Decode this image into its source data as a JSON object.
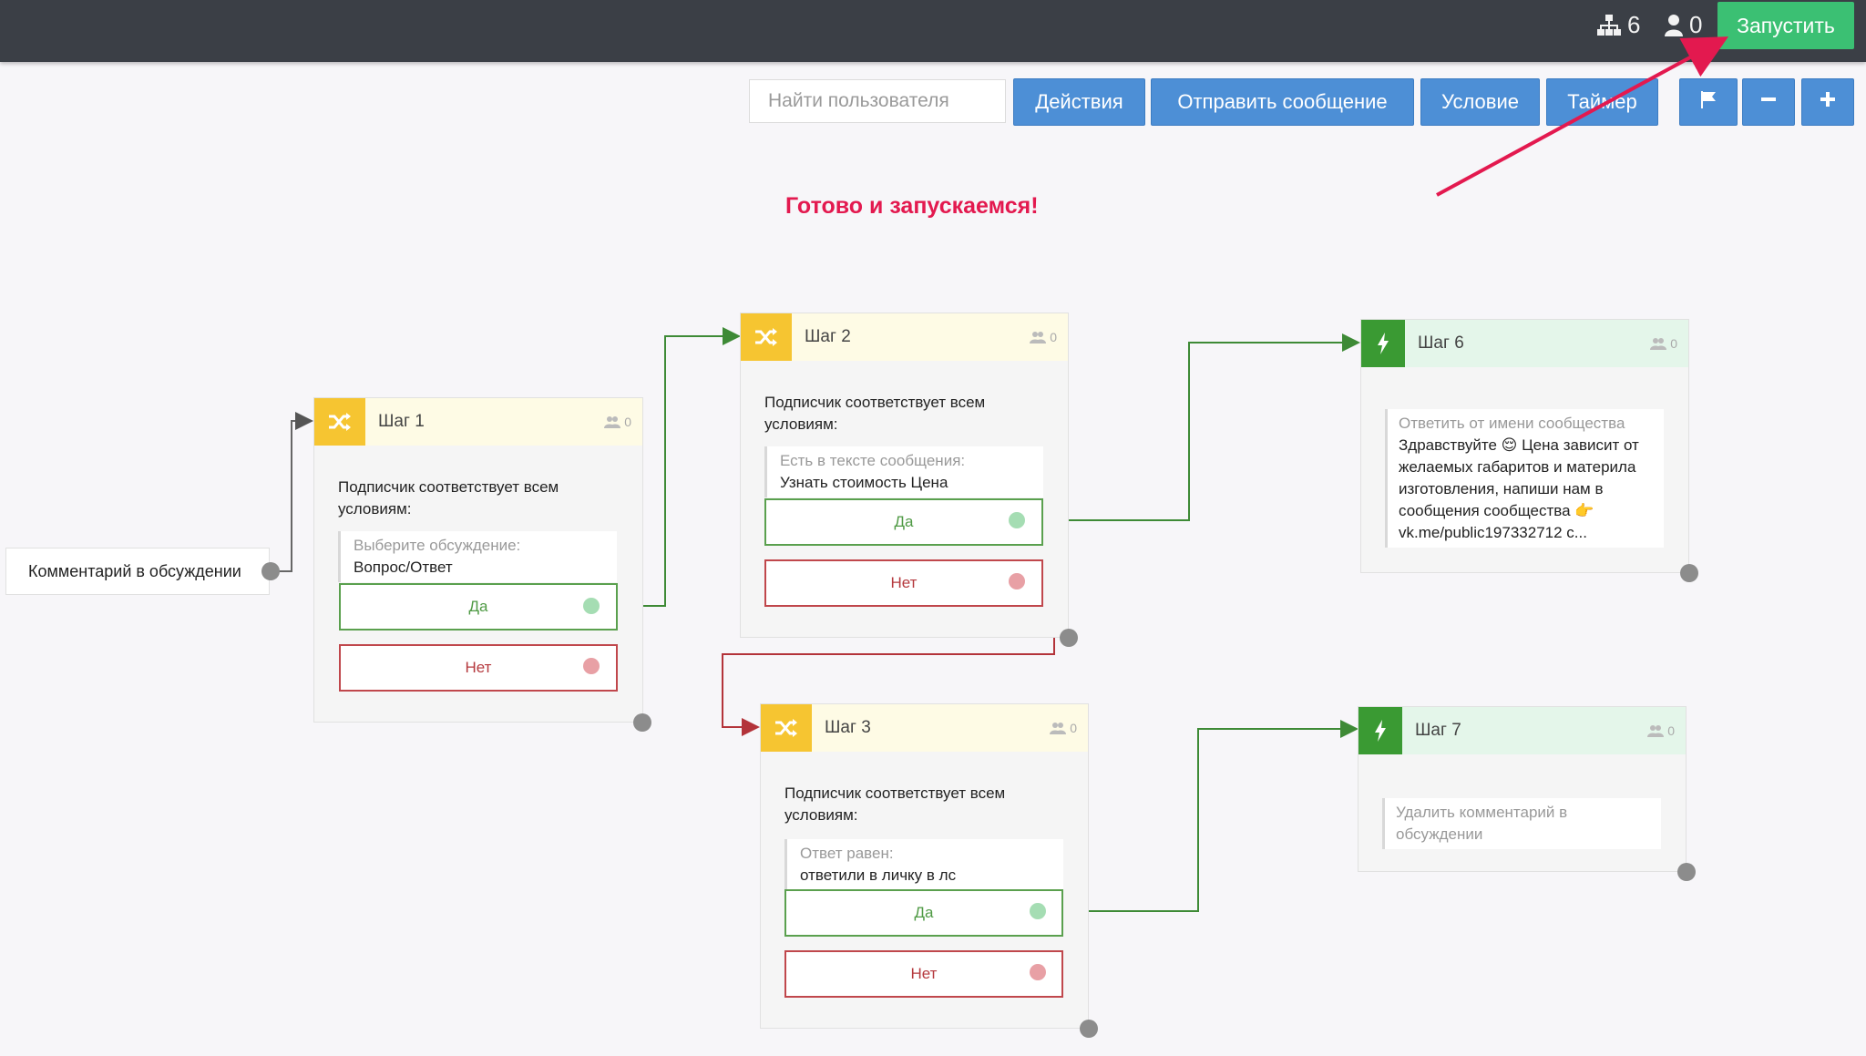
{
  "topbar": {
    "nodes_count": "6",
    "users_count": "0",
    "run_label": "Запустить"
  },
  "toolbar": {
    "search_placeholder": "Найти пользователя",
    "actions_label": "Действия",
    "send_message_label": "Отправить сообщение",
    "condition_label": "Условие",
    "timer_label": "Таймер"
  },
  "annotation": {
    "text": "Готово и запускаемся!",
    "color": "#e3194f"
  },
  "trigger": {
    "label": "Комментарий в обсуждении"
  },
  "steps": {
    "step1": {
      "title": "Шаг 1",
      "count": "0",
      "condition_text": "Подписчик соответствует всем условиям:",
      "cond_label": "Выберите обсуждение:",
      "cond_value": "Вопрос/Ответ",
      "yes": "Да",
      "no": "Нет"
    },
    "step2": {
      "title": "Шаг 2",
      "count": "0",
      "condition_text": "Подписчик соответствует всем условиям:",
      "cond_label": "Есть в тексте сообщения:",
      "cond_value": "Узнать стоимость Цена",
      "yes": "Да",
      "no": "Нет"
    },
    "step3": {
      "title": "Шаг 3",
      "count": "0",
      "condition_text": "Подписчик соответствует всем условиям:",
      "cond_label": "Ответ равен:",
      "cond_value": "ответили в личку в лс",
      "yes": "Да",
      "no": "Нет"
    },
    "step6": {
      "title": "Шаг 6",
      "count": "0",
      "action_label": "Ответить от имени сообщества",
      "action_text": "Здравствуйте 😌 Цена зависит от желаемых габаритов и материла изготовления, напиши нам в сообщения сообщества 👉 vk.me/public197332712 c..."
    },
    "step7": {
      "title": "Шаг 7",
      "count": "0",
      "action_label": "Удалить комментарий в обсуждении"
    }
  },
  "colors": {
    "condition_accent": "#f6c531",
    "action_accent": "#3a9a33",
    "yes_border": "#5aa04e",
    "no_border": "#c0474c",
    "run_button": "#3bc073",
    "toolbar_button": "#4d8fd6"
  }
}
